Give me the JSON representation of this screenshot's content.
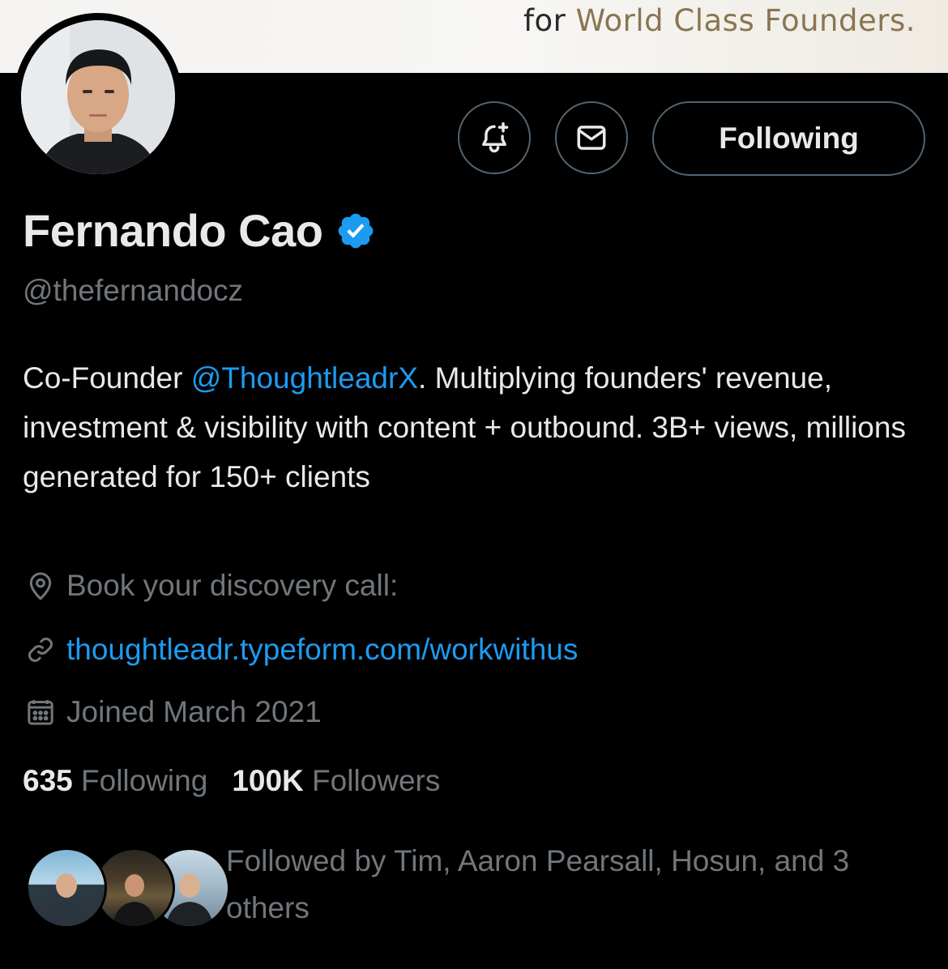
{
  "banner": {
    "text_prefix": "for ",
    "text_accent": "World Class Founders."
  },
  "profile": {
    "name": "Fernando Cao",
    "handle": "@thefernandocz",
    "verified": true,
    "bio_prefix": "Co-Founder ",
    "bio_mention": "@ThoughtleadrX",
    "bio_suffix": ". Multiplying founders' revenue, investment & visibility with content + outbound. 3B+ views, millions generated for 150+ clients",
    "location": "Book your discovery call:",
    "website": "thoughtleadr.typeform.com/workwithus",
    "joined": "Joined March 2021"
  },
  "actions": {
    "notify_icon": "bell-plus-icon",
    "message_icon": "envelope-icon",
    "follow_label": "Following"
  },
  "stats": {
    "following_count": "635",
    "following_label": "Following",
    "followers_count": "100K",
    "followers_label": "Followers"
  },
  "followed_by": {
    "text": "Followed by Tim, Aaron Pearsall, Hosun, and 3 others",
    "avatar_count": 3
  },
  "colors": {
    "background": "#000000",
    "primary_text": "#e7e9ea",
    "secondary_text": "#71767b",
    "link": "#1d9bf0",
    "button_border": "#536471"
  }
}
